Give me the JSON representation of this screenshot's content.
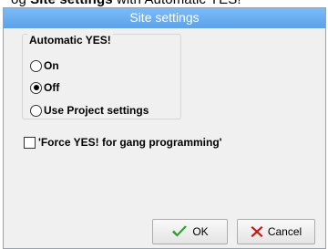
{
  "caption": {
    "text_prefix": "og ",
    "text_bold": "Site settings",
    "text_suffix": " with Automatic YES!"
  },
  "dialog": {
    "title": "Site settings",
    "title_bar_color": "#69adf0"
  },
  "automatic_yes": {
    "label": "Automatic YES!",
    "options": [
      {
        "label": "On",
        "checked": false
      },
      {
        "label": "Off",
        "checked": true
      },
      {
        "label": "Use Project settings",
        "checked": false
      }
    ]
  },
  "force_yes": {
    "label": "'Force YES! for gang programming'",
    "checked": false
  },
  "buttons": {
    "ok_label": "OK",
    "ok_icon": "green-checkmark-icon",
    "cancel_label": "Cancel",
    "cancel_icon": "red-x-icon"
  },
  "colors": {
    "ok_icon": "#2e9e2e",
    "cancel_icon": "#cc1111"
  }
}
